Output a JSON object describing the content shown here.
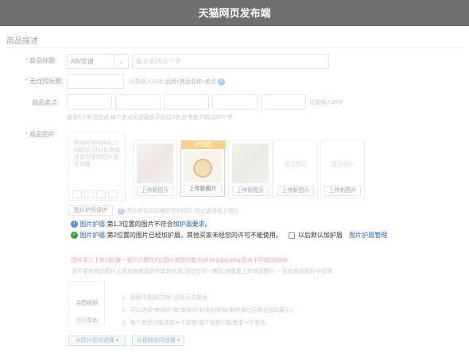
{
  "window": {
    "title": "天猫网页发布端"
  },
  "section": {
    "title": "商品描述"
  },
  "fields": {
    "product_title_label": "商品标题:",
    "product_title_select": "AB/艾迪",
    "product_title_placeholder": "最多支持30个字",
    "wireless_title_label": "无线短标题:",
    "wireless_title_hint": "还能输入10字",
    "wireless_title_hint2": "品牌+商品名称+卖点",
    "selling_points_label": "商品卖点:",
    "selling_points_hint": "还能输入20字",
    "selling_points_sub": "最多5个卖点短语,每个卖点短语最多不超过8字,总字数不超过20个字",
    "product_images_label": "商品图片:"
  },
  "images": {
    "upload_tip": "800px*800px以上的图片,可以在商品详情页提供图片放大功能",
    "upload_new": "上传新图片",
    "empty_label": "暂无图片",
    "protect_badge": "护视图"
  },
  "protect": {
    "button_label": "图片护视保护",
    "button_tip": "图片护视可以保护您的图片,防止盗用他人图片"
  },
  "notice": {
    "row1_prefix": "图片护眉:",
    "row1_text": "第1,3位置的图片不符合",
    "row1_link": "加护眉要求",
    "row1_suffix": "。",
    "row2_prefix": "图片护眉:",
    "row2_text": "第2位置的图片已经加护眉。其他买家未经您的许可不能使用。",
    "row2_checkbox": "以后默认加护眉",
    "row2_link": "图片护眉管理"
  },
  "upload_hints": {
    "red": "图片至少上传1张(第一张不计算在内);图片类型只能为gif,png,jpg,jpeg;且大小不超过500K",
    "gray": "请不要在商品图片上添加除商品外的其他信息,请勿在同一商品,或重复上传商品图片,一张在商品图片中出现"
  },
  "video": {
    "label": "主图视频",
    "link": "使用",
    "link2": "帮助",
    "rules": [
      "1、视频不能超过9秒,否则无法使用;",
      "2、可以选择\"审核中\"和\"审核中\"状态的视频(审核通过后即会自动展示);",
      "3、每个商品只能选择一个视频,每个视频只能使用一个商品。"
    ]
  },
  "buttons": {
    "from_space": "从图片空间选择 ▾",
    "from_space2": "从视频空间选择 ▾"
  },
  "colors": {
    "accent": "#2766b8",
    "badge": "#f39800",
    "error": "#e4393c",
    "success": "#3aa335"
  }
}
